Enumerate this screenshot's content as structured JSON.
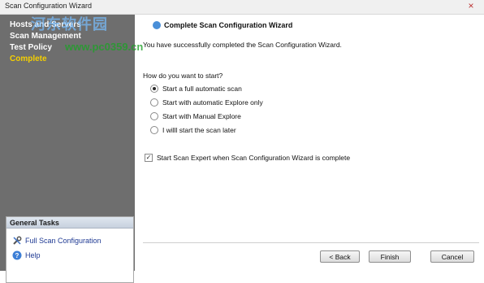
{
  "window": {
    "title": "Scan Configuration Wizard",
    "close_glyph": "×"
  },
  "sidebar": {
    "steps": [
      {
        "label": "Hosts and Servers",
        "active": false
      },
      {
        "label": "Scan Management",
        "active": false
      },
      {
        "label": "Test Policy",
        "active": false
      },
      {
        "label": "Complete",
        "active": true
      }
    ],
    "tasks_header": "General Tasks",
    "tasks": [
      {
        "label": "Full Scan Configuration",
        "icon": "wrench-icon"
      },
      {
        "label": "Help",
        "icon": "help-icon"
      }
    ]
  },
  "main": {
    "heading": "Complete Scan Configuration Wizard",
    "description": "You have successfully completed the Scan Configuration Wizard.",
    "question": "How do you want to start?",
    "options": [
      {
        "label": "Start a full automatic scan",
        "checked": true
      },
      {
        "label": "Start with automatic Explore only",
        "checked": false
      },
      {
        "label": "Start with Manual Explore",
        "checked": false
      },
      {
        "label": "I willl start the scan later",
        "checked": false
      }
    ],
    "checkbox": {
      "label": "Start Scan Expert when Scan Configuration Wizard is complete",
      "checked": true
    }
  },
  "buttons": {
    "back": "< Back",
    "finish": "Finish",
    "cancel": "Cancel"
  },
  "watermark": {
    "line1": "河东软件园",
    "line2": "www.pc0359.cn"
  }
}
